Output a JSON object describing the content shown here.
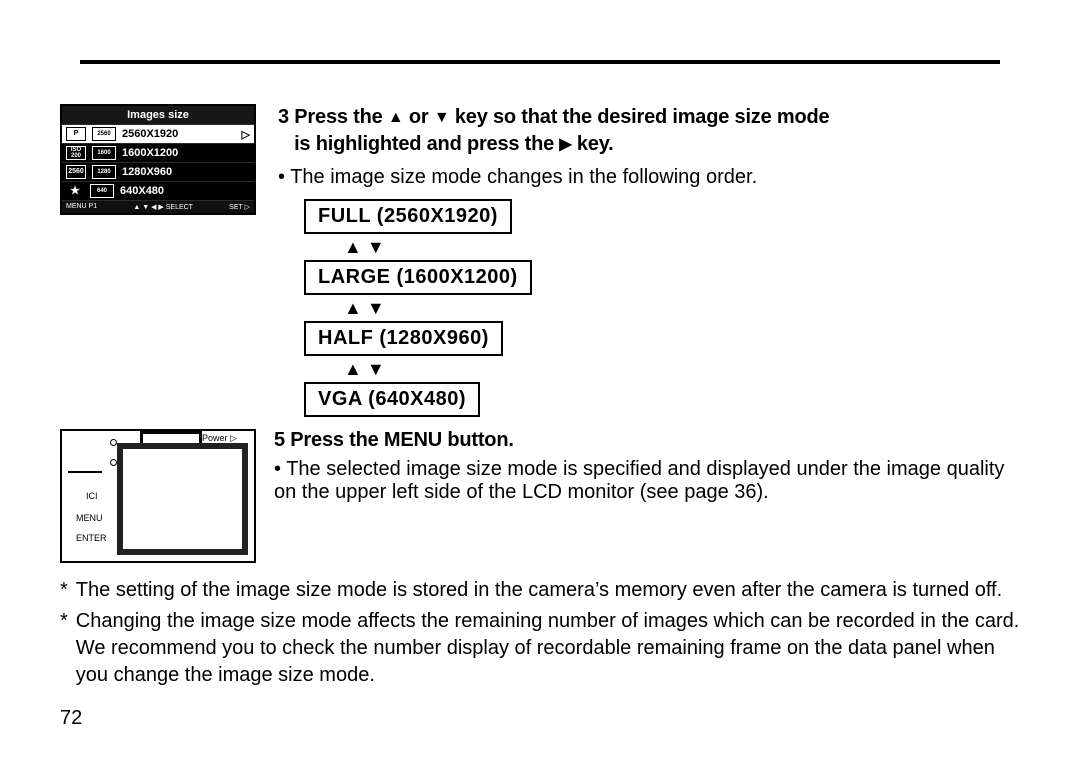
{
  "page_number": "72",
  "rule": true,
  "lcd": {
    "title": "Images size",
    "p_marker": "P",
    "rows": [
      {
        "ico1": "2560",
        "ico2": "2560",
        "label": "2560X1920",
        "selected": true,
        "trail": "▷"
      },
      {
        "ico1": "ISO 200",
        "ico2": "1600",
        "label": "1600X1200",
        "selected": false
      },
      {
        "ico1": "2560",
        "ico2": "1280",
        "label": "1280X960",
        "selected": false
      },
      {
        "ico1": "★",
        "ico2": "640",
        "label": "640X480",
        "selected": false
      }
    ],
    "footer_left": "MENU P1",
    "footer_mid": "▲ ▼ ◀ ▶ SELECT",
    "footer_right": "SET ▷"
  },
  "step3": {
    "num": "3",
    "line1a": "Press the ",
    "tri_up": "▲",
    "line1b": " or ",
    "tri_down": "▼",
    "line1c": " key so that the desired image size mode",
    "line2a": "is highlighted and press the ",
    "tri_right": "▶",
    "line2b": " key."
  },
  "step3_bullet": "• The image size mode changes in the following order.",
  "sizes": [
    "FULL (2560X1920)",
    "LARGE (1600X1200)",
    "HALF (1280X960)",
    "VGA (640X480)"
  ],
  "arrows_between": "▲   ▼",
  "camera_illus": {
    "menu": "MENU",
    "enter": "ENTER",
    "ici": "ICI",
    "power": "Power ▷"
  },
  "step5": {
    "num": "5",
    "text": "Press the MENU button."
  },
  "step5_bullet": "• The selected image size mode is specified and displayed under the image quality on the upper left side of the LCD monitor (see page 36).",
  "note1": "The setting of the image size mode is stored in the camera’s memory even after the camera is turned off.",
  "note2": "Changing the image size mode affects the remaining number of images which can be recorded in the card. We recommend you to check the number display of recordable remaining frame on the data panel when you change the image size mode."
}
